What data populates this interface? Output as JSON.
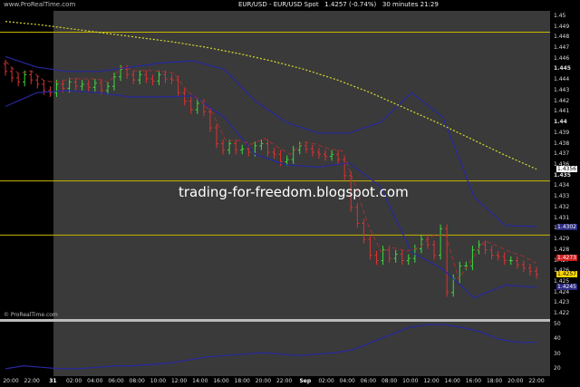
{
  "header": {
    "brand": "www.ProRealTime.com",
    "title": "EUR/USD - EUR/USD Spot",
    "last": "1.4257 (-0.74%)",
    "interval": "30 minutes",
    "time": "21:29"
  },
  "watermark": "trading-for-freedom.blogspot.com",
  "footer": "© ProRealTime.com",
  "price_axis": {
    "ticks": [
      "1.45",
      "1.449",
      "1.448",
      "1.447",
      "1.446",
      "1.445",
      "1.444",
      "1.443",
      "1.442",
      "1.441",
      "1.44",
      "1.439",
      "1.438",
      "1.437",
      "1.436",
      "1.435",
      "1.434",
      "1.433",
      "1.432",
      "1.431",
      "1.43",
      "1.429",
      "1.428",
      "1.427",
      "1.426",
      "1.425",
      "1.424",
      "1.423",
      "1.422"
    ],
    "range": [
      1.4215,
      1.4505
    ]
  },
  "badges": [
    {
      "text": "1.4356",
      "bg": "#ffffff",
      "fg": "#000000"
    },
    {
      "text": "1.4302",
      "bg": "#2a2a80",
      "fg": "#ffffff"
    },
    {
      "text": "1.4273",
      "bg": "#d02020",
      "fg": "#ffffff"
    },
    {
      "text": "1.4257",
      "bg": "#ffd700",
      "fg": "#000000"
    },
    {
      "text": "1.4245",
      "bg": "#2a2a80",
      "fg": "#ffffff"
    }
  ],
  "indicator_axis": {
    "ticks": [
      "50",
      "40",
      "30",
      "20"
    ],
    "range": [
      15,
      52
    ]
  },
  "time_axis": {
    "labels": [
      "20:00",
      "22:00",
      "31",
      "02:00",
      "04:00",
      "06:00",
      "08:00",
      "10:00",
      "12:00",
      "14:00",
      "16:00",
      "18:00",
      "20:00",
      "22:00",
      "Sep",
      "02:00",
      "04:00",
      "06:00",
      "08:00",
      "10:00",
      "12:00",
      "14:00",
      "16:00",
      "18:00",
      "20:00",
      "22:00"
    ]
  },
  "levels": [
    1.4485,
    1.4345,
    1.4294
  ],
  "colors": {
    "up": "#3ddc3d",
    "down": "#e03030",
    "band": "#2828a0",
    "sma": "#d9d930",
    "level": "#c8b400",
    "trend": "#a03030"
  },
  "chart_data": {
    "type": "line",
    "instrument": "EUR/USD",
    "candles": {
      "open": [
        1.4455,
        1.4448,
        1.4442,
        1.4438,
        1.4445,
        1.444,
        1.4436,
        1.443,
        1.4428,
        1.4436,
        1.4432,
        1.4438,
        1.4434,
        1.4436,
        1.4433,
        1.4437,
        1.443,
        1.4434,
        1.4443,
        1.445,
        1.4445,
        1.444,
        1.4445,
        1.4441,
        1.4439,
        1.4445,
        1.4441,
        1.444,
        1.4428,
        1.442,
        1.4412,
        1.4418,
        1.441,
        1.4395,
        1.438,
        1.4374,
        1.438,
        1.4374,
        1.4375,
        1.4372,
        1.4378,
        1.438,
        1.4372,
        1.437,
        1.4363,
        1.4365,
        1.4374,
        1.4378,
        1.4375,
        1.4372,
        1.437,
        1.4368,
        1.437,
        1.4365,
        1.435,
        1.432,
        1.4305,
        1.429,
        1.4275,
        1.427,
        1.428,
        1.4272,
        1.4276,
        1.427,
        1.4272,
        1.4281,
        1.429,
        1.4285,
        1.4275,
        1.43,
        1.424,
        1.4253,
        1.4265,
        1.4265,
        1.428,
        1.4285,
        1.428,
        1.4275,
        1.4274,
        1.427,
        1.427,
        1.4266,
        1.4263,
        1.426
      ],
      "close": [
        1.4448,
        1.4442,
        1.4438,
        1.4445,
        1.444,
        1.4436,
        1.443,
        1.4428,
        1.4436,
        1.4432,
        1.4438,
        1.4434,
        1.4436,
        1.4433,
        1.4437,
        1.443,
        1.4434,
        1.4443,
        1.445,
        1.4445,
        1.444,
        1.4445,
        1.4441,
        1.4439,
        1.4445,
        1.4441,
        1.444,
        1.4428,
        1.442,
        1.4412,
        1.4418,
        1.441,
        1.4395,
        1.438,
        1.4374,
        1.438,
        1.4374,
        1.4375,
        1.4372,
        1.4378,
        1.438,
        1.4372,
        1.437,
        1.4363,
        1.4365,
        1.4374,
        1.4378,
        1.4375,
        1.4372,
        1.437,
        1.4368,
        1.437,
        1.4365,
        1.435,
        1.432,
        1.4305,
        1.429,
        1.4275,
        1.427,
        1.428,
        1.4272,
        1.4276,
        1.427,
        1.4272,
        1.4281,
        1.429,
        1.4285,
        1.4275,
        1.43,
        1.424,
        1.4253,
        1.4265,
        1.4265,
        1.428,
        1.4285,
        1.428,
        1.4275,
        1.4274,
        1.427,
        1.427,
        1.4266,
        1.4263,
        1.426,
        1.4257
      ]
    },
    "sma_series": [
      1.4495,
      1.4492,
      1.4488,
      1.4484,
      1.448,
      1.4476,
      1.4471,
      1.4465,
      1.4458,
      1.445,
      1.444,
      1.4428,
      1.4414,
      1.44,
      1.4385,
      1.437,
      1.4356
    ],
    "upper_band": [
      1.4462,
      1.4452,
      1.4448,
      1.4448,
      1.4452,
      1.4456,
      1.4458,
      1.445,
      1.442,
      1.44,
      1.439,
      1.439,
      1.44,
      1.4428,
      1.4405,
      1.433,
      1.4303,
      1.4302
    ],
    "lower_band": [
      1.4415,
      1.4428,
      1.443,
      1.4428,
      1.4424,
      1.4424,
      1.4425,
      1.4405,
      1.437,
      1.436,
      1.4358,
      1.4362,
      1.434,
      1.4278,
      1.4262,
      1.4235,
      1.4247,
      1.4245
    ],
    "indicator": {
      "name": "",
      "values": [
        20,
        22,
        21,
        20,
        20,
        21,
        22,
        22,
        23,
        24,
        26,
        28,
        29,
        30,
        31,
        30,
        29,
        30,
        31,
        33,
        38,
        43,
        48,
        50,
        50,
        48,
        45,
        40,
        38,
        38
      ]
    }
  }
}
